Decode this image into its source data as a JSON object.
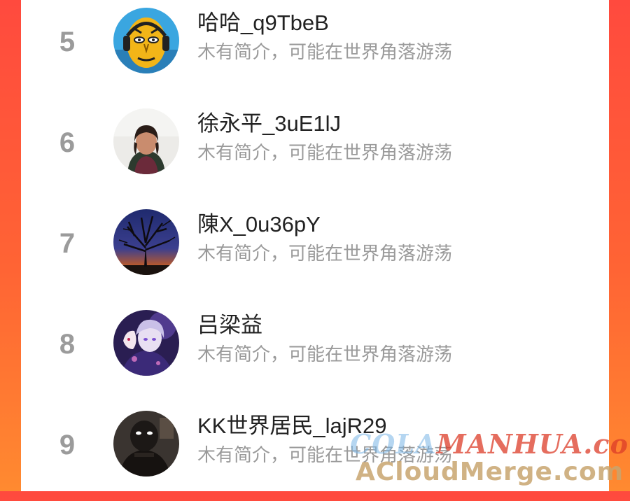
{
  "ranking": {
    "items": [
      {
        "rank": "5",
        "name": "哈哈_q9TbeB",
        "bio": "木有简介，可能在世界角落游荡",
        "avatar": "cartoon-face-avatar"
      },
      {
        "rank": "6",
        "name": "徐永平_3uE1lJ",
        "bio": "木有简介，可能在世界角落游荡",
        "avatar": "woman-photo-avatar"
      },
      {
        "rank": "7",
        "name": "陳X_0u36pY",
        "bio": "木有简介，可能在世界角落游荡",
        "avatar": "tree-at-dusk-avatar"
      },
      {
        "rank": "8",
        "name": "吕梁益",
        "bio": "木有简介，可能在世界角落游荡",
        "avatar": "anime-character-avatar"
      },
      {
        "rank": "9",
        "name": "KK世界居民_lajR29",
        "bio": "木有简介，可能在世界角落游荡",
        "avatar": "dark-figure-avatar"
      }
    ]
  },
  "watermark": {
    "line1_part1": "COLA",
    "line1_part2": "MANHUA.com",
    "line2": "ACloudMerge.com"
  }
}
